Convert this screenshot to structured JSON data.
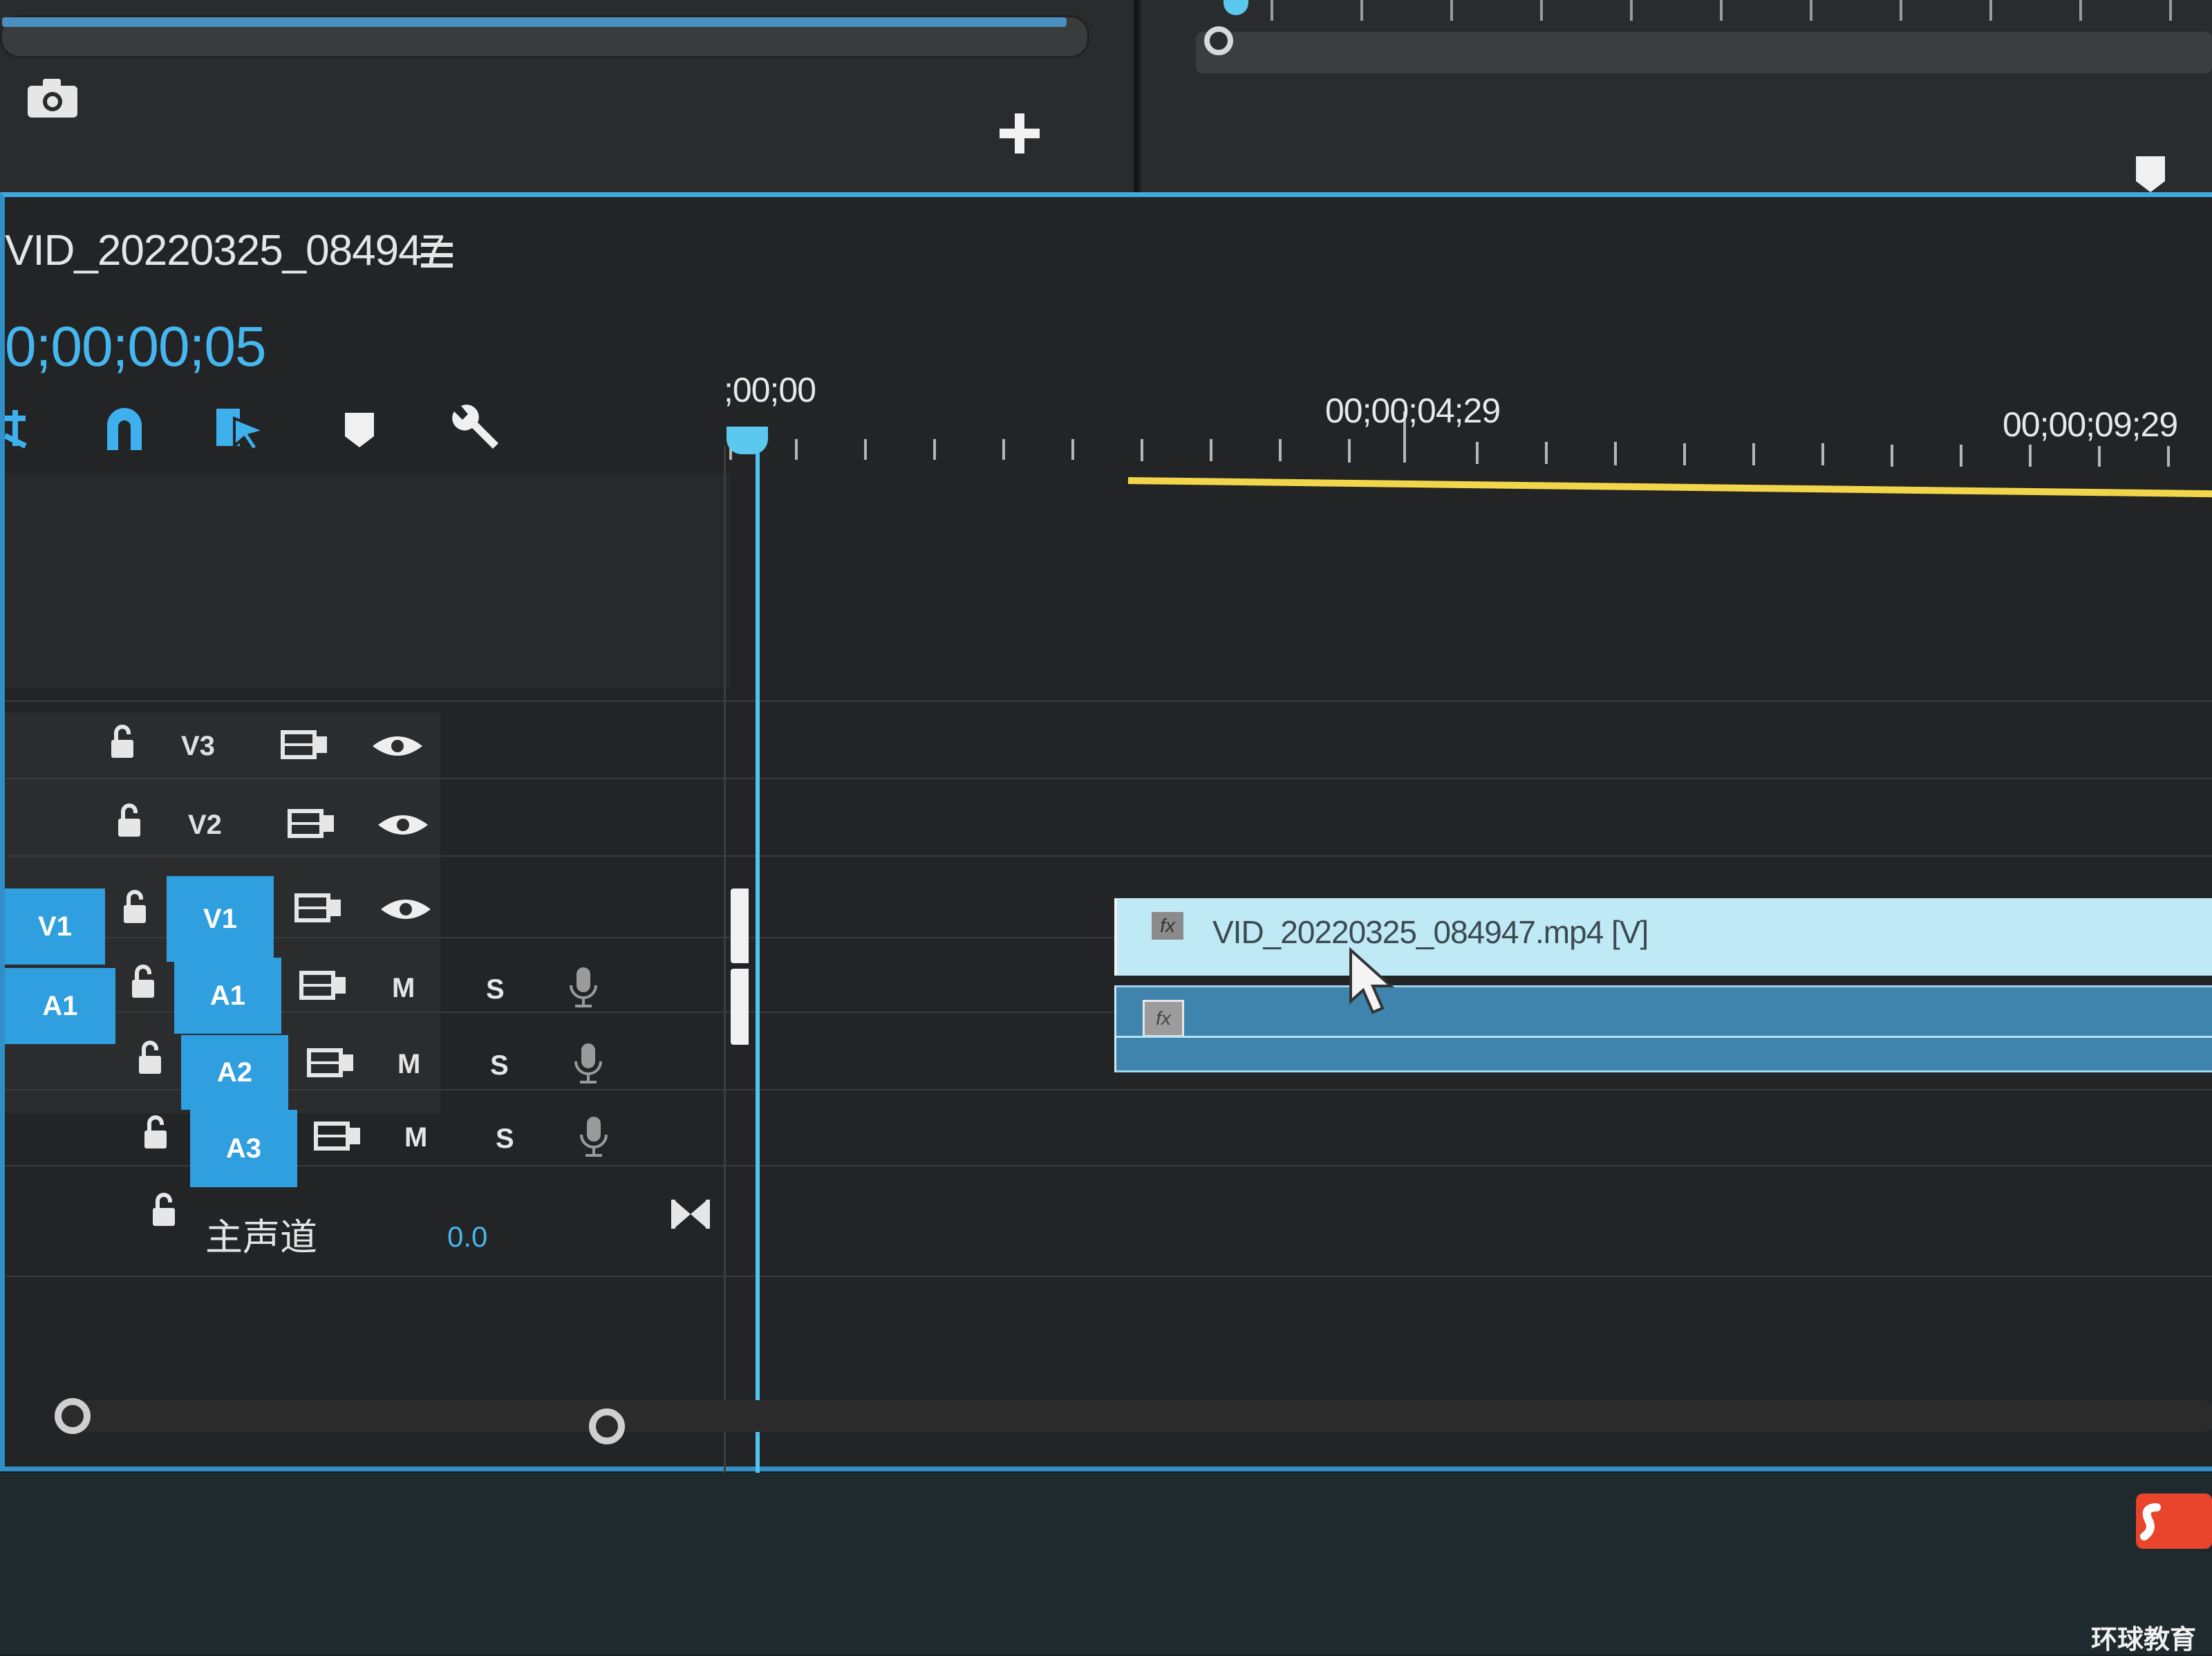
{
  "sequence": {
    "title": "VID_20220325_084947",
    "timecode": "0;00;00;05"
  },
  "ruler": {
    "labels": [
      ";00;00",
      "00;00;04;29",
      "00;00;09;29"
    ]
  },
  "tracks": {
    "video": [
      {
        "label": "V3",
        "source_patch": ""
      },
      {
        "label": "V2",
        "source_patch": ""
      },
      {
        "label": "V1",
        "source_patch": "V1"
      }
    ],
    "audio": [
      {
        "label": "A1",
        "source_patch": "A1",
        "mute": "M",
        "solo": "S"
      },
      {
        "label": "A2",
        "source_patch": "",
        "mute": "M",
        "solo": "S"
      },
      {
        "label": "A3",
        "source_patch": "",
        "mute": "M",
        "solo": "S"
      }
    ],
    "master": {
      "label": "主声道",
      "value": "0.0"
    }
  },
  "clips": {
    "video_clip_name": "VID_20220325_084947.mp4 [V]",
    "fx_badge": "fx"
  },
  "icons": {
    "top_left": [
      "camera-icon",
      "add-icon"
    ],
    "top_right": [
      "marker-icon"
    ],
    "toolbar": [
      "snap-icon",
      "linked-selection-icon",
      "add-marker-icon",
      "settings-wrench-icon"
    ],
    "track": [
      "lock-icon",
      "sync-lock-icon",
      "eye-icon",
      "voice-over-mic-icon"
    ]
  },
  "watermark": {
    "text": "环球教育"
  },
  "colors": {
    "accent": "#2f9fe0",
    "playhead": "#4fc3f0",
    "work_area": "#f1d64c",
    "video_clip": "#bfeaf5",
    "audio_clip": "#3e84ad"
  }
}
